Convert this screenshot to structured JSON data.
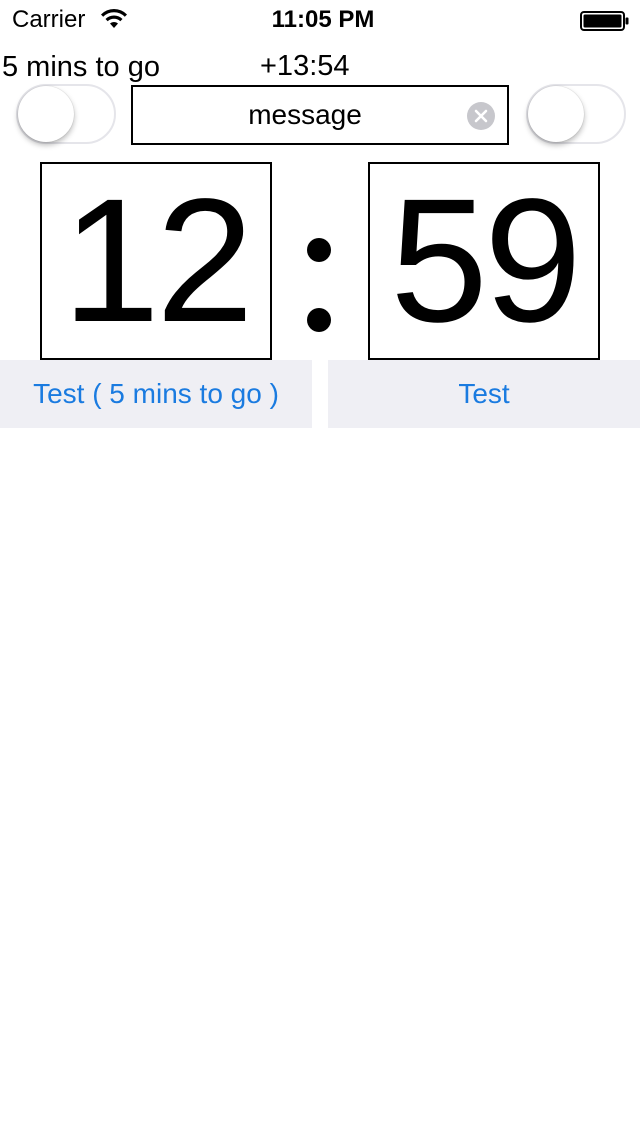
{
  "status_bar": {
    "carrier": "Carrier",
    "time": "11:05 PM",
    "wifi_icon": "wifi-icon",
    "battery_icon": "battery-icon",
    "battery_level": 1.0
  },
  "info": {
    "countdown": "5 mins to go",
    "offset": "+13:54"
  },
  "controls": {
    "toggle_left_on": false,
    "toggle_right_on": false,
    "message_value": "message",
    "clear_icon": "clear-circle-icon"
  },
  "timer": {
    "hours": "12",
    "separator": ":",
    "minutes": "59"
  },
  "buttons": {
    "left_label": "Test ( 5 mins to go )",
    "right_label": "Test"
  },
  "colors": {
    "accent": "#1a7be0",
    "button_background": "#efeff4",
    "toggle_border": "#e5e5ea"
  }
}
